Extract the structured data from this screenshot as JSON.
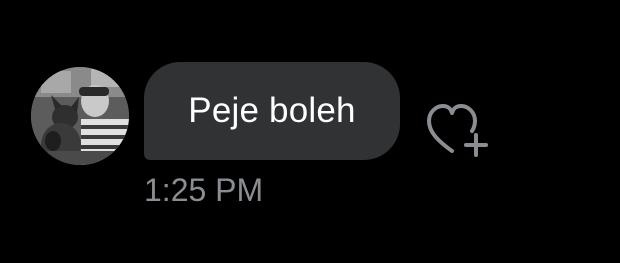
{
  "message": {
    "text": "Peje boleh",
    "timestamp": "1:25 PM"
  },
  "sender": {
    "avatar_icon": "profile-photo-avatar"
  },
  "reaction": {
    "icon": "heart-plus-icon"
  },
  "colors": {
    "background": "#000000",
    "bubble": "#303234",
    "message_text": "#ffffff",
    "timestamp": "#8a8d91",
    "reaction_icon": "#8a8d91"
  }
}
